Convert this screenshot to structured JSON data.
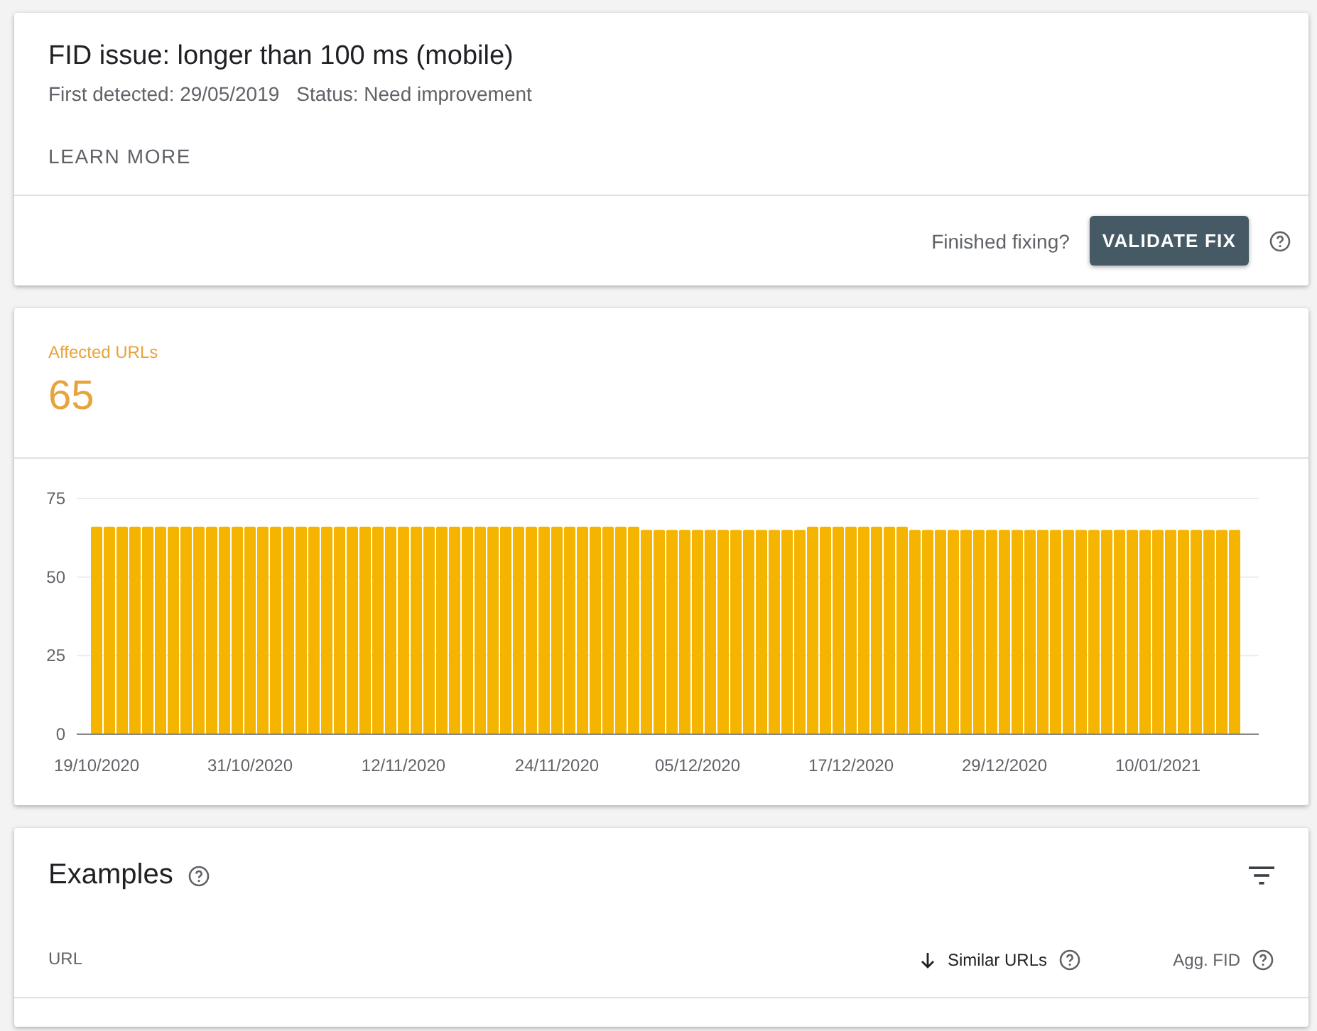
{
  "issue": {
    "title": "FID issue: longer than 100 ms (mobile)",
    "first_detected": "First detected: 29/05/2019",
    "status": "Status: Need improvement",
    "learn_more": "LEARN MORE",
    "prompt": "Finished fixing?",
    "validate_button": "VALIDATE FIX"
  },
  "affected": {
    "label": "Affected URLs",
    "count": "65",
    "chart_data": {
      "type": "bar",
      "categories": [
        "19/10/2020",
        null,
        null,
        null,
        null,
        null,
        null,
        null,
        null,
        null,
        null,
        null,
        "31/10/2020",
        null,
        null,
        null,
        null,
        null,
        null,
        null,
        null,
        null,
        null,
        null,
        "12/11/2020",
        null,
        null,
        null,
        null,
        null,
        null,
        null,
        null,
        null,
        null,
        null,
        "24/11/2020",
        null,
        null,
        null,
        null,
        null,
        null,
        null,
        null,
        null,
        null,
        "05/12/2020",
        null,
        null,
        null,
        null,
        null,
        null,
        null,
        null,
        null,
        null,
        null,
        "17/12/2020",
        null,
        null,
        null,
        null,
        null,
        null,
        null,
        null,
        null,
        null,
        null,
        "29/12/2020",
        null,
        null,
        null,
        null,
        null,
        null,
        null,
        null,
        null,
        null,
        null,
        "10/01/2021",
        null,
        null,
        null,
        null,
        null,
        null
      ],
      "series": [
        {
          "color": "#f4b400",
          "values": [
            66,
            66,
            66,
            66,
            66,
            66,
            66,
            66,
            66,
            66,
            66,
            66,
            66,
            66,
            66,
            66,
            66,
            66,
            66,
            66,
            66,
            66,
            66,
            66,
            66,
            66,
            66,
            66,
            66,
            66,
            66,
            66,
            66,
            66,
            66,
            66,
            66,
            66,
            66,
            66,
            66,
            66,
            66,
            65,
            65,
            65,
            65,
            65,
            65,
            65,
            65,
            65,
            65,
            65,
            65,
            65,
            66,
            66,
            66,
            66,
            66,
            66,
            66,
            66,
            65,
            65,
            65,
            65,
            65,
            65,
            65,
            65,
            65,
            65,
            65,
            65,
            65,
            65,
            65,
            65,
            65,
            65,
            65,
            65,
            65,
            65,
            65,
            65,
            65,
            65
          ]
        }
      ],
      "ylim": [
        0,
        75
      ],
      "yticks": [
        0,
        25,
        50,
        75
      ]
    }
  },
  "examples": {
    "title": "Examples",
    "columns": [
      {
        "label": "URL",
        "sorted": false,
        "help": false
      },
      {
        "label": "Similar URLs",
        "sorted": true,
        "help": true
      },
      {
        "label": "Agg. FID",
        "sorted": false,
        "help": true
      }
    ]
  }
}
